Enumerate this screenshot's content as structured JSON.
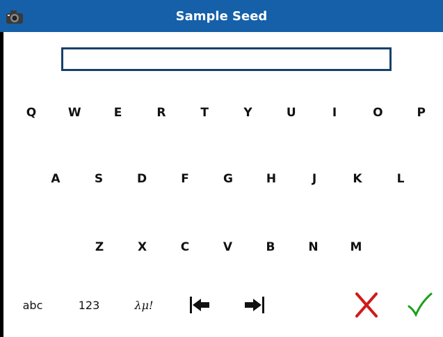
{
  "window": {
    "title": "Sample Seed"
  },
  "input": {
    "value": ""
  },
  "keyboard": {
    "row1": [
      "Q",
      "W",
      "E",
      "R",
      "T",
      "Y",
      "U",
      "I",
      "O",
      "P"
    ],
    "row2": [
      "A",
      "S",
      "D",
      "F",
      "G",
      "H",
      "J",
      "K",
      "L"
    ],
    "row3": [
      "Z",
      "X",
      "C",
      "V",
      "B",
      "N",
      "M"
    ]
  },
  "bottom_bar": {
    "abc_label": "abc",
    "numbers_label": "123",
    "symbols_label": "λμ!"
  },
  "colors": {
    "titlebar": "#1560a8",
    "cancel": "#d01a1a",
    "confirm": "#1aa01a"
  }
}
